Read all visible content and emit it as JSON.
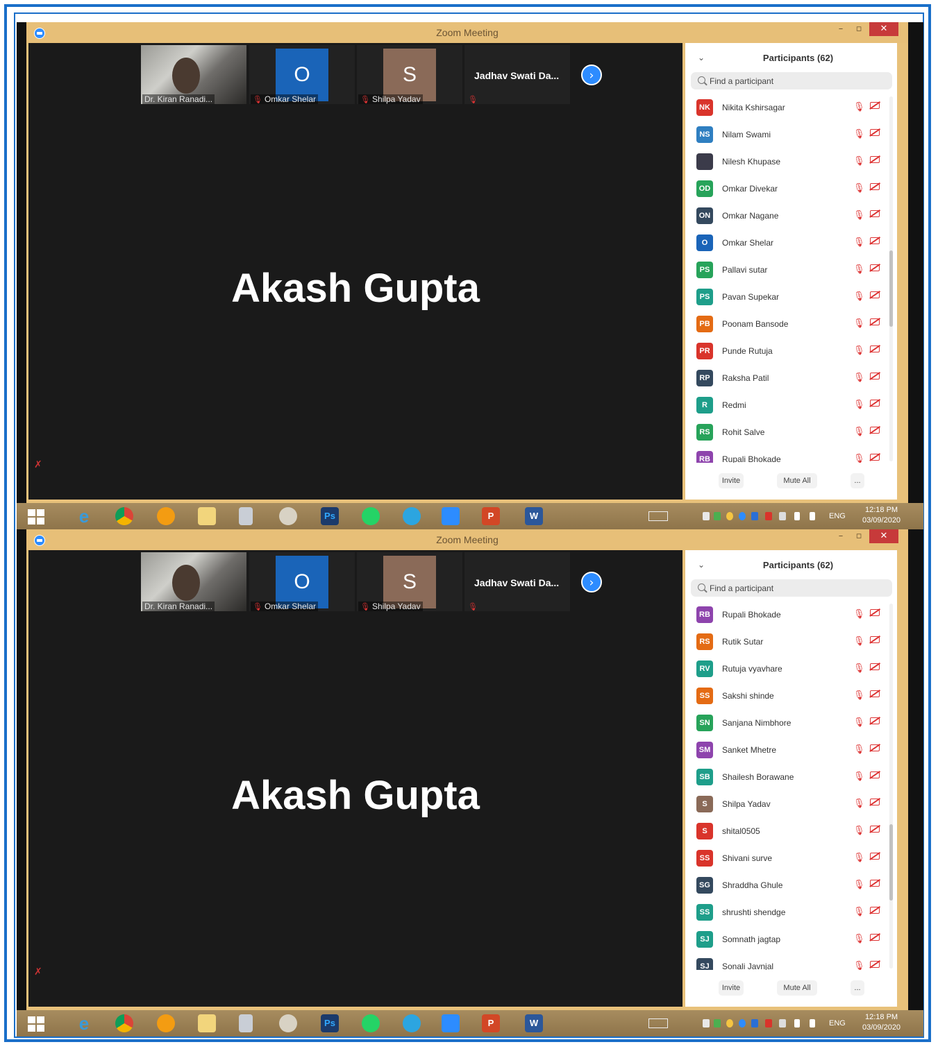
{
  "window": {
    "title": "Zoom Meeting",
    "minimize": "–",
    "maximize": "▫",
    "close": "✕"
  },
  "gallery": {
    "tiles": [
      {
        "name": "Dr. Kiran Ranadi...",
        "type": "video"
      },
      {
        "name": "Omkar Shelar",
        "letter": "O",
        "color": "#1a64b8"
      },
      {
        "name": "Shilpa Yadav",
        "letter": "S",
        "color": "#8a6a58"
      },
      {
        "name": "Jadhav Swati Da..."
      }
    ],
    "next_icon": "chevron-right-icon"
  },
  "active_speaker": "Akash Gupta",
  "participants_panel": {
    "title": "Participants (62)",
    "search_placeholder": "Find a participant",
    "invite": "Invite",
    "mute_all": "Mute All",
    "more": "..."
  },
  "screenshot_1_participants": [
    {
      "initials": "NK",
      "name": "Nikita Kshirsagar",
      "color": "#d9342b"
    },
    {
      "initials": "NS",
      "name": "Nilam Swami",
      "color": "#2f7fc1"
    },
    {
      "initials": "",
      "name": "Nilesh Khupase",
      "color": "#3b3b4a"
    },
    {
      "initials": "OD",
      "name": "Omkar Divekar",
      "color": "#27a35a"
    },
    {
      "initials": "ON",
      "name": "Omkar Nagane",
      "color": "#34495e"
    },
    {
      "initials": "O",
      "name": "Omkar Shelar",
      "color": "#1a64b8"
    },
    {
      "initials": "PS",
      "name": "Pallavi sutar",
      "color": "#27a35a"
    },
    {
      "initials": "PS",
      "name": "Pavan Supekar",
      "color": "#1e9e8a"
    },
    {
      "initials": "PB",
      "name": "Poonam Bansode",
      "color": "#e46b14"
    },
    {
      "initials": "PR",
      "name": "Punde Rutuja",
      "color": "#d9342b"
    },
    {
      "initials": "RP",
      "name": "Raksha Patil",
      "color": "#34495e"
    },
    {
      "initials": "R",
      "name": "Redmi",
      "color": "#1e9e8a"
    },
    {
      "initials": "RS",
      "name": "Rohit Salve",
      "color": "#27a35a"
    },
    {
      "initials": "RB",
      "name": "Rupali Bhokade",
      "color": "#8e44ad"
    }
  ],
  "screenshot_2_participants": [
    {
      "initials": "RB",
      "name": "Rupali Bhokade",
      "color": "#8e44ad"
    },
    {
      "initials": "RS",
      "name": "Rutik Sutar",
      "color": "#e46b14"
    },
    {
      "initials": "RV",
      "name": "Rutuja vyavhare",
      "color": "#1e9e8a"
    },
    {
      "initials": "SS",
      "name": "Sakshi shinde",
      "color": "#e46b14"
    },
    {
      "initials": "SN",
      "name": "Sanjana Nimbhore",
      "color": "#27a35a"
    },
    {
      "initials": "SM",
      "name": "Sanket Mhetre",
      "color": "#8e44ad"
    },
    {
      "initials": "SB",
      "name": "Shailesh Borawane",
      "color": "#1e9e8a"
    },
    {
      "initials": "S",
      "name": "Shilpa Yadav",
      "color": "#8a6a58"
    },
    {
      "initials": "S",
      "name": "shital0505",
      "color": "#d9342b"
    },
    {
      "initials": "SS",
      "name": "Shivani surve",
      "color": "#d9342b"
    },
    {
      "initials": "SG",
      "name": "Shraddha Ghule",
      "color": "#34495e"
    },
    {
      "initials": "SS",
      "name": "shrushti shendge",
      "color": "#1e9e8a"
    },
    {
      "initials": "SJ",
      "name": "Somnath jagtap",
      "color": "#1e9e8a"
    },
    {
      "initials": "SJ",
      "name": "Sonali Javnjal",
      "color": "#34495e"
    }
  ],
  "taskbar": {
    "language": "ENG",
    "time": "12:18 PM",
    "date": "03/09/2020",
    "apps": [
      "start-icon",
      "internet-explorer-icon",
      "chrome-icon",
      "vlc-icon",
      "file-explorer-icon",
      "calculator-icon",
      "paint-icon",
      "photoshop-icon",
      "whatsapp-icon",
      "telegram-icon",
      "zoom-icon",
      "powerpoint-icon",
      "word-icon"
    ],
    "photoshop_label": "Ps",
    "powerpoint_label": "P",
    "word_label": "W"
  },
  "colors": {
    "frame_blue": "#1a6fc9",
    "titlebar": "#e7bf78",
    "zoom_blue": "#2d8cff",
    "muted_red": "#d33333"
  }
}
